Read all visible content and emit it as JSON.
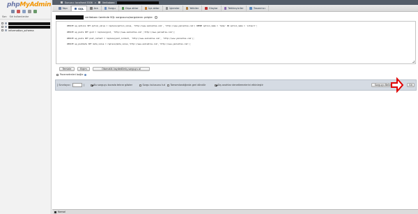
{
  "nav": {
    "logo_php": "php",
    "logo_admin": "MyAdmin",
    "tab_recent": "Son",
    "tab_favorites": "Sık kullanılanlar",
    "tree": [
      {
        "label": "",
        "redacted": true
      },
      {
        "label": "",
        "redacted": true
      },
      {
        "label": "information_schema",
        "redacted": false
      }
    ]
  },
  "topbar": {
    "server": "Sunucu: localhost:3306",
    "database": "Veritabanı:"
  },
  "tabs": [
    {
      "label": "Yapı",
      "icon": "structure-icon",
      "color": "#6a7fa3"
    },
    {
      "label": "SQL",
      "icon": "sql-icon",
      "color": "#4c6c9e",
      "active": true
    },
    {
      "label": "Ara",
      "icon": "search-icon",
      "color": "#7a7a7a"
    },
    {
      "label": "Sorgu",
      "icon": "query-icon",
      "color": "#6a8ec0"
    },
    {
      "label": "Dışa aktar",
      "icon": "export-icon",
      "color": "#4a8f4a"
    },
    {
      "label": "İçe aktar",
      "icon": "import-icon",
      "color": "#c47a2a"
    },
    {
      "label": "İşlemler",
      "icon": "wrench-icon",
      "color": "#8a8a8a"
    },
    {
      "label": "Yetkiler",
      "icon": "privileges-icon",
      "color": "#b07a3a"
    },
    {
      "label": "Olaylar",
      "icon": "events-icon",
      "color": "#c03030"
    },
    {
      "label": "Tetikleyiciler",
      "icon": "triggers-icon",
      "color": "#8a6ab0"
    },
    {
      "label": "Tasarımcı",
      "icon": "designer-icon",
      "color": "#5a8ac0"
    }
  ],
  "query_heading": "veritabanı üzerinde SQL sorgusunu/sorgularını çalıştır:",
  "sql_lines": [
    "UPDATE wp_options SET option_value = replace(option_value, 'http://www.eskiadres.com', 'http://www.yeniadres.com') WHERE option_name = 'home' OR option_name = 'siteurl';",
    "UPDATE wp_posts SET guid = replace(guid, 'http://www.eskiadres.com','http://www.yeniadres.com');",
    "UPDATE wp_posts SET post_content = replace(post_content, 'http://www.eskiadres.com', 'http://www.yeniadres.com');",
    "UPDATE wp_postmeta SET meta_value = replace(meta_value,'http://www.eskiadres.com','http://www.yeniadres.com');"
  ],
  "buttons": {
    "clear": "Temizle",
    "format": "Biçim",
    "get_autosaved": "Otomatik kaydedilmiş sorguyu al"
  },
  "bind_params": "Parametreleri bağla",
  "options": {
    "delimiter_label": "[ Sınırlayıcı",
    "delimiter_value": ";",
    "delimiter_close": "]",
    "show_query": "Bu sorguyu burada tekrar göster",
    "retain_box": "Sorgu kutusunu tut",
    "rollback": "Tamamlandığında geri döndür",
    "fk_checks": "Dış anahtar denetlemelerini etkinleştir",
    "bookmark_btn": "Sorguyu Bellekle",
    "go_btn": "Git"
  },
  "console": "Konsol",
  "colors": {
    "accent": "#e00000",
    "options_bg": "#d5dbe3",
    "topbar_bg": "#555e6a"
  }
}
